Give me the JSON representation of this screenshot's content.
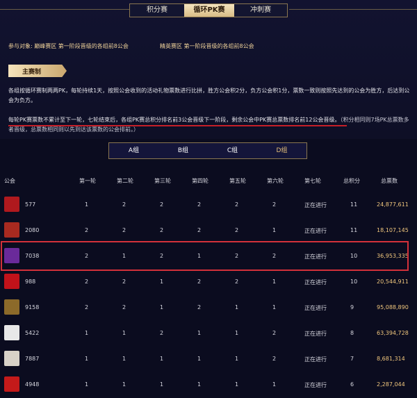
{
  "tabs": [
    {
      "label": "积分赛",
      "active": false
    },
    {
      "label": "循环PK赛",
      "active": true
    },
    {
      "label": "冲刺赛",
      "active": false
    }
  ],
  "participants": {
    "label": "参与对象:",
    "peak": "巅峰赛区 第一阶段晋级的各组前8公会",
    "elite": "精英赛区 第一阶段晋级的各组前8公会"
  },
  "section_title": "主赛制",
  "desc1": "各组按循环赛制两两PK，每轮持续1天，按照公会收到的活动礼物票数进行比拼，胜方公会积2分，负方公会积1分，票数一致则按照先达到的公会为胜方，后达到公会为负方。",
  "desc2_main": "每轮PK赛票数不累计至下一轮，七轮结束后，各组PK赛总积分排名前3公会晋级下一阶段，剩余公会中PK赛总票数排名前12公会晋级。",
  "desc2_note": "（积分相同则7场PK总票数多者晋级，总票数相同则以先到达该票数的公会排前。）",
  "groups": [
    {
      "label": "A组",
      "selected": false
    },
    {
      "label": "B组",
      "selected": false
    },
    {
      "label": "C组",
      "selected": false
    },
    {
      "label": "D组",
      "selected": true
    }
  ],
  "columns": [
    "公会",
    "第一轮",
    "第二轮",
    "第三轮",
    "第四轮",
    "第五轮",
    "第六轮",
    "第七轮",
    "总积分",
    "总票数"
  ],
  "rows": [
    {
      "id": "577",
      "r": [
        "1",
        "2",
        "2",
        "2",
        "2",
        "2"
      ],
      "r7": "正在进行",
      "score": "11",
      "votes": "24,877,611",
      "logo": "#b0191e"
    },
    {
      "id": "2080",
      "r": [
        "2",
        "2",
        "2",
        "2",
        "2",
        "1"
      ],
      "r7": "正在进行",
      "score": "11",
      "votes": "18,107,145",
      "logo": "#a82a20"
    },
    {
      "id": "7038",
      "r": [
        "2",
        "1",
        "2",
        "1",
        "2",
        "2"
      ],
      "r7": "正在进行",
      "score": "10",
      "votes": "36,953,335",
      "logo": "#6a2a9a"
    },
    {
      "id": "988",
      "r": [
        "2",
        "2",
        "1",
        "2",
        "2",
        "1"
      ],
      "r7": "正在进行",
      "score": "10",
      "votes": "20,544,911",
      "logo": "#c1121a"
    },
    {
      "id": "9158",
      "r": [
        "2",
        "2",
        "1",
        "2",
        "1",
        "1"
      ],
      "r7": "正在进行",
      "score": "9",
      "votes": "95,088,890",
      "logo": "#8c6a2a"
    },
    {
      "id": "5422",
      "r": [
        "1",
        "1",
        "2",
        "1",
        "1",
        "2"
      ],
      "r7": "正在进行",
      "score": "8",
      "votes": "63,394,728",
      "logo": "#e8e8e8"
    },
    {
      "id": "7887",
      "r": [
        "1",
        "1",
        "1",
        "1",
        "1",
        "2"
      ],
      "r7": "正在进行",
      "score": "7",
      "votes": "8,681,314",
      "logo": "#d8d2c8"
    },
    {
      "id": "4948",
      "r": [
        "1",
        "1",
        "1",
        "1",
        "1",
        "1"
      ],
      "r7": "正在进行",
      "score": "6",
      "votes": "2,287,044",
      "logo": "#c41a1a"
    }
  ]
}
